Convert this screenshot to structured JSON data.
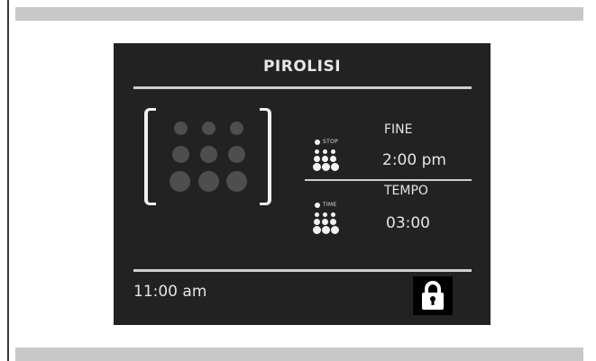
{
  "screen": {
    "title": "PIROLISI",
    "program_icon": "pyrolysis-program-icon",
    "end": {
      "indicator_label": "STOP",
      "label": "FINE",
      "value": "2:00 pm",
      "icon": "stop-time-icon"
    },
    "duration": {
      "indicator_label": "TIME",
      "label": "TEMPO",
      "value": "03:00",
      "icon": "duration-icon"
    },
    "clock": "11:00 am",
    "lock_icon": "padlock-icon"
  },
  "colors": {
    "panel_bg": "#222222",
    "frame_bar": "#c8c8c8",
    "text": "#e4e4e4",
    "inactive_dot": "#4e4e4e"
  }
}
